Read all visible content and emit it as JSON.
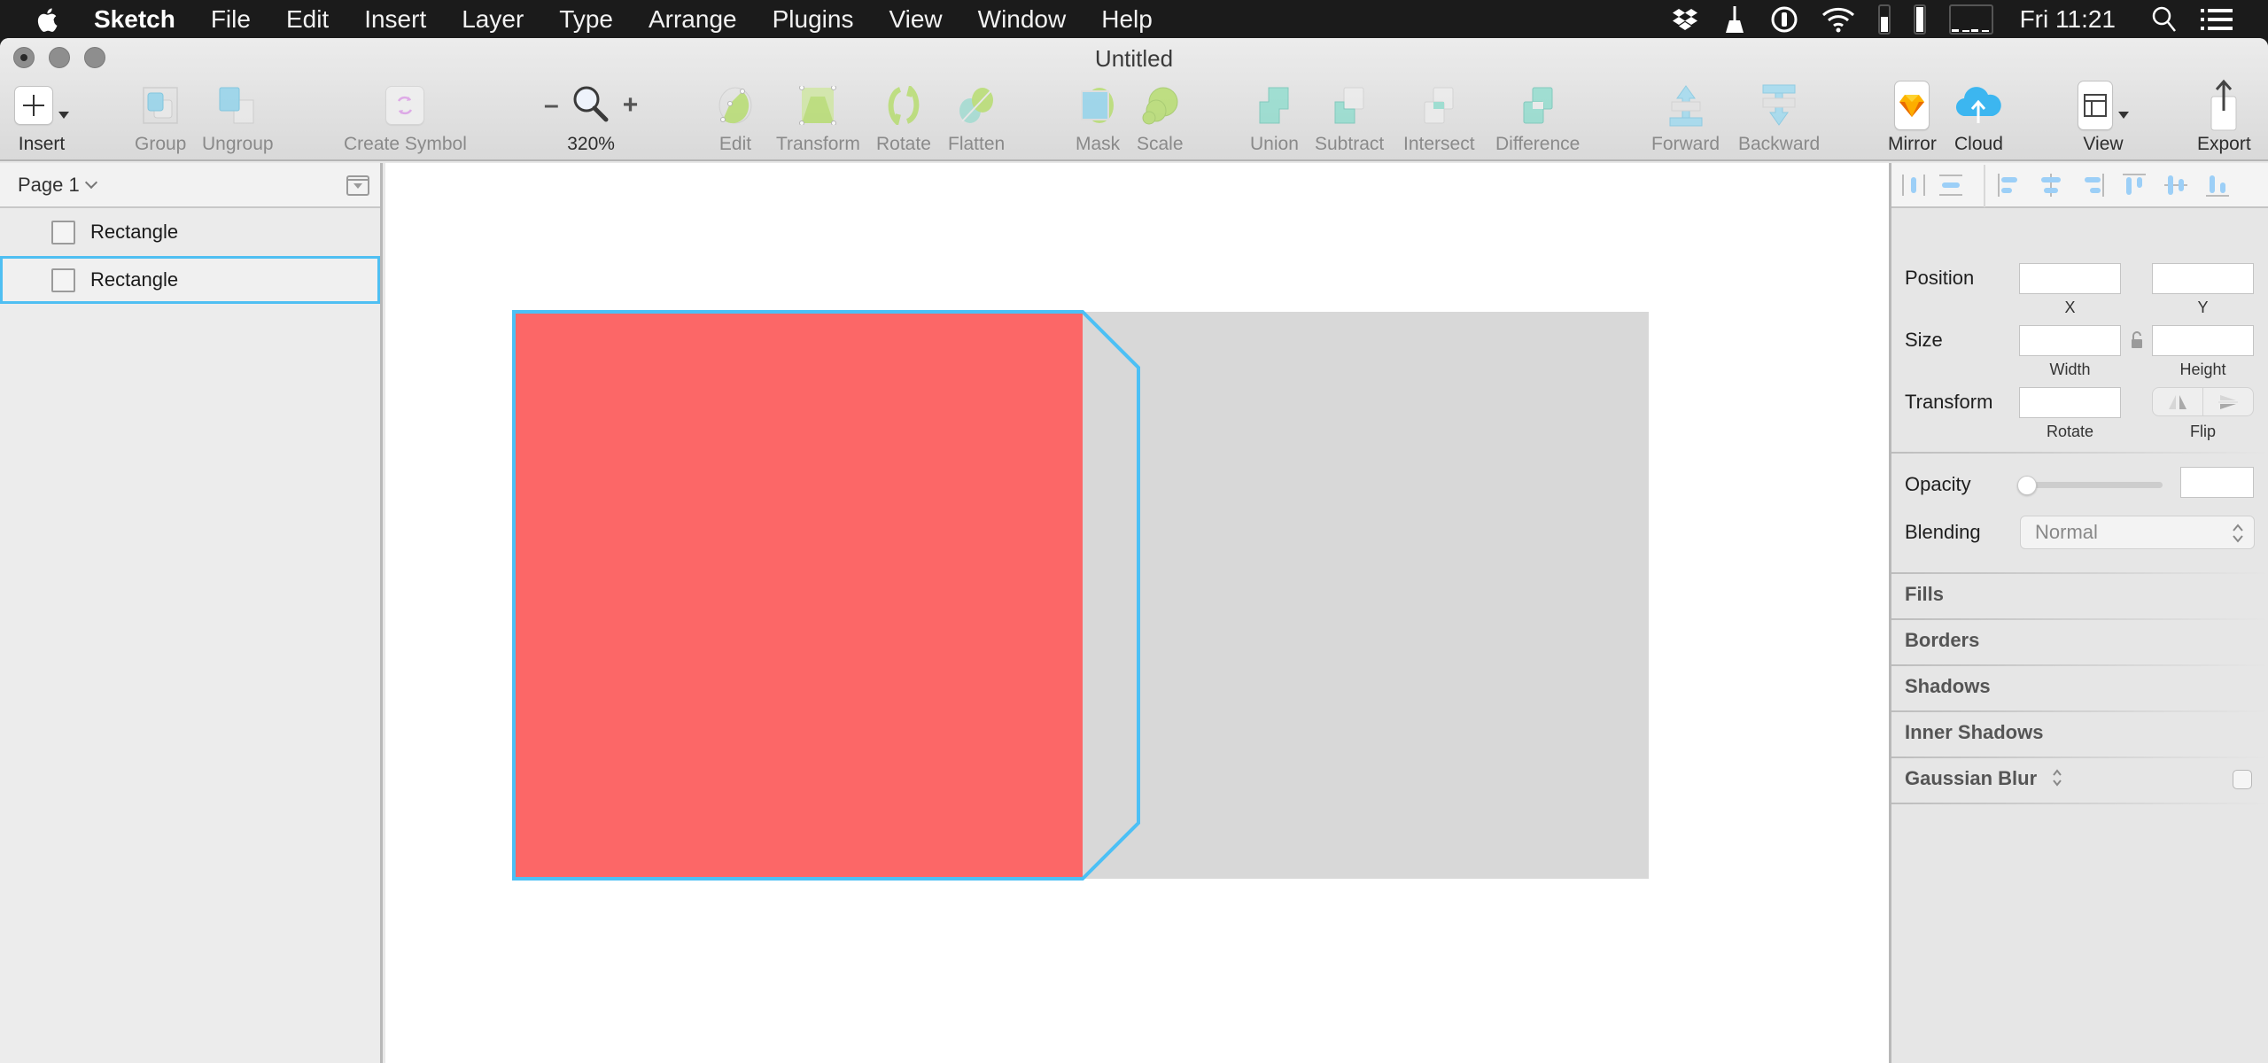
{
  "menubar": {
    "app_name": "Sketch",
    "items": [
      "File",
      "Edit",
      "Insert",
      "Layer",
      "Type",
      "Arrange",
      "Plugins",
      "View",
      "Window",
      "Help"
    ],
    "clock": "Fri 11:21",
    "status_icons": [
      "dropbox-icon",
      "cleaner-icon",
      "password-manager-icon",
      "wifi-icon",
      "battery-gauge-icon",
      "battery-gauge-icon",
      "menu-meter-icon",
      "spotlight-search-icon",
      "notification-center-icon"
    ]
  },
  "window": {
    "title": "Untitled"
  },
  "toolbar": {
    "insert": "Insert",
    "group": "Group",
    "ungroup": "Ungroup",
    "create_symbol": "Create Symbol",
    "zoom_minus": "–",
    "zoom_plus": "+",
    "zoom_level": "320%",
    "edit": "Edit",
    "transform": "Transform",
    "rotate": "Rotate",
    "flatten": "Flatten",
    "mask": "Mask",
    "scale": "Scale",
    "union": "Union",
    "subtract": "Subtract",
    "intersect": "Intersect",
    "difference": "Difference",
    "forward": "Forward",
    "backward": "Backward",
    "mirror": "Mirror",
    "cloud": "Cloud",
    "view": "View",
    "export": "Export"
  },
  "layers": {
    "page_name": "Page 1",
    "items": [
      {
        "name": "Rectangle",
        "selected": false
      },
      {
        "name": "Rectangle",
        "selected": true
      }
    ]
  },
  "canvas": {
    "shapes": [
      {
        "name": "Rectangle",
        "fill": "#FC6767"
      },
      {
        "name": "Rectangle",
        "fill": "#D8D8D8"
      }
    ],
    "selection_color": "#4CC0F5"
  },
  "inspector": {
    "position_label": "Position",
    "x_label": "X",
    "y_label": "Y",
    "x_value": "",
    "y_value": "",
    "size_label": "Size",
    "width_label": "Width",
    "height_label": "Height",
    "width_value": "",
    "height_value": "",
    "transform_label": "Transform",
    "rotate_label": "Rotate",
    "rotate_value": "",
    "flip_label": "Flip",
    "opacity_label": "Opacity",
    "opacity_value": "",
    "opacity_level": 0,
    "blending_label": "Blending",
    "blending_value": "Normal",
    "sections": [
      "Fills",
      "Borders",
      "Shadows",
      "Inner Shadows",
      "Gaussian Blur"
    ],
    "gaussian_blur_enabled": false
  }
}
